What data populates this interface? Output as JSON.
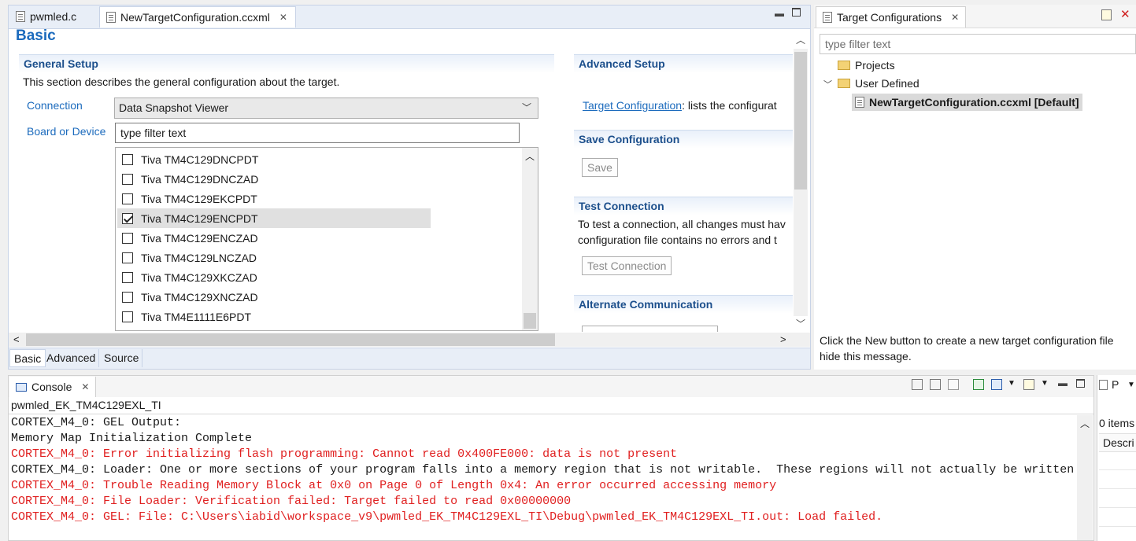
{
  "editor": {
    "tabs": [
      {
        "label": "pwmled.c"
      },
      {
        "label": "NewTargetConfiguration.ccxml"
      }
    ],
    "page_title": "Basic",
    "general_setup": {
      "title": "General Setup",
      "description": "This section describes the general configuration about the target.",
      "connection_label": "Connection",
      "connection_value": "Data Snapshot Viewer",
      "board_label": "Board or Device",
      "filter_value": "type filter text",
      "devices": [
        {
          "name": "Tiva TM4C129DNCPDT",
          "checked": false
        },
        {
          "name": "Tiva TM4C129DNCZAD",
          "checked": false
        },
        {
          "name": "Tiva TM4C129EKCPDT",
          "checked": false
        },
        {
          "name": "Tiva TM4C129ENCPDT",
          "checked": true
        },
        {
          "name": "Tiva TM4C129ENCZAD",
          "checked": false
        },
        {
          "name": "Tiva TM4C129LNCZAD",
          "checked": false
        },
        {
          "name": "Tiva TM4C129XKCZAD",
          "checked": false
        },
        {
          "name": "Tiva TM4C129XNCZAD",
          "checked": false
        },
        {
          "name": "Tiva TM4E1111E6PDT",
          "checked": false
        }
      ]
    },
    "advanced_setup": {
      "title": "Advanced Setup",
      "link": "Target Configuration",
      "link_rest": ": lists the configurat"
    },
    "save_configuration": {
      "title": "Save Configuration",
      "button": "Save"
    },
    "test_connection": {
      "title": "Test Connection",
      "line1": "To test a connection, all changes must hav",
      "line2": "configuration file contains no errors and t",
      "button": "Test Connection"
    },
    "alternate_communication": {
      "title": "Alternate Communication"
    },
    "bottom_tabs": [
      {
        "label": "Basic"
      },
      {
        "label": "Advanced"
      },
      {
        "label": "Source"
      }
    ]
  },
  "target_configs": {
    "title": "Target Configurations",
    "filter_placeholder": "type filter text",
    "tree": {
      "projects": "Projects",
      "user_defined": "User Defined",
      "file": "NewTargetConfiguration.ccxml [Default]"
    },
    "message_line1": "Click the New button to create a new target configuration file",
    "message_line2": "hide this message."
  },
  "console": {
    "title": "Console",
    "subtitle": "pwmled_EK_TM4C129EXL_TI",
    "lines": [
      {
        "text": "CORTEX_M4_0: GEL Output:",
        "error": false
      },
      {
        "text": "Memory Map Initialization Complete",
        "error": false
      },
      {
        "text": "CORTEX_M4_0: Error initializing flash programming: Cannot read 0x400FE000: data is not present",
        "error": true
      },
      {
        "text": "CORTEX_M4_0: Loader: One or more sections of your program falls into a memory region that is not writable.  These regions will not actually be written",
        "error": false
      },
      {
        "text": "CORTEX_M4_0: Trouble Reading Memory Block at 0x0 on Page 0 of Length 0x4: An error occurred accessing memory",
        "error": true
      },
      {
        "text": "CORTEX_M4_0: File Loader: Verification failed: Target failed to read 0x00000000",
        "error": true
      },
      {
        "text": "CORTEX_M4_0: GEL: File: C:\\Users\\iabid\\workspace_v9\\pwmled_EK_TM4C129EXL_TI\\Debug\\pwmled_EK_TM4C129EXL_TI.out: Load failed.",
        "error": true
      }
    ]
  },
  "problems": {
    "tab": "P",
    "count": "0 items",
    "col": "Descri"
  },
  "colors": {
    "accent": "#1c4f8c",
    "link": "#1c6bbd",
    "error": "#e02020"
  }
}
